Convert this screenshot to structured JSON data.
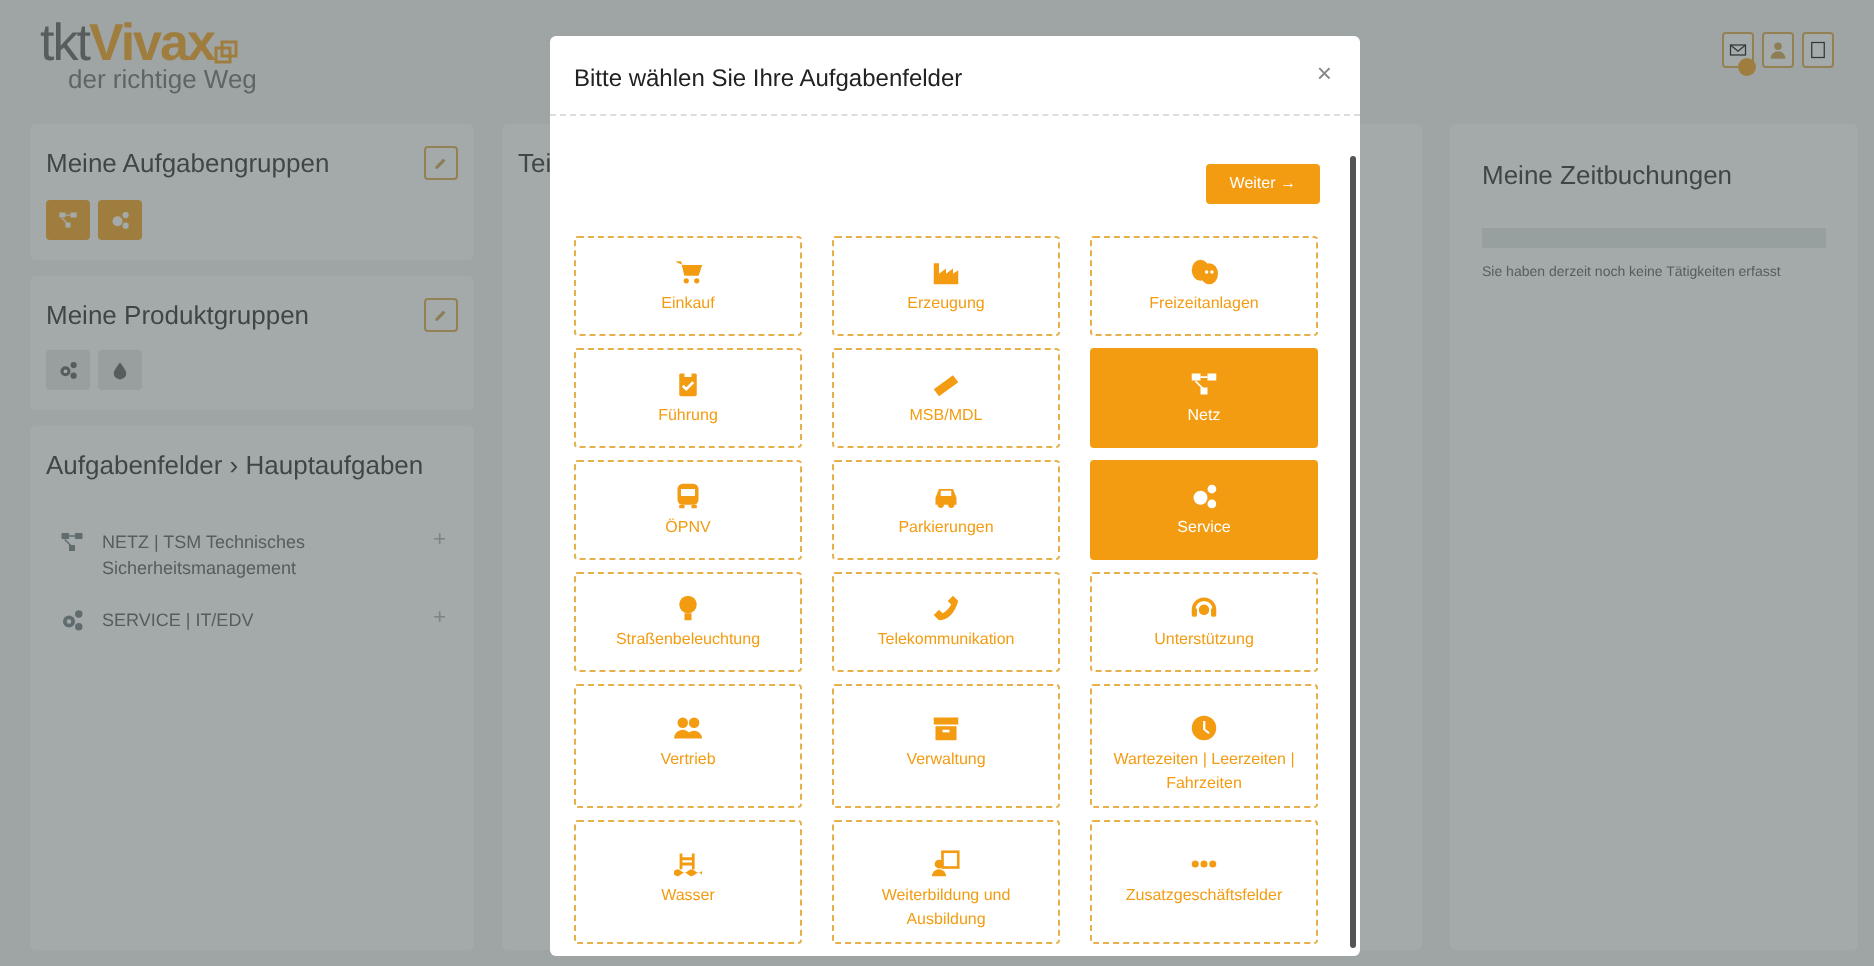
{
  "header": {
    "logo_prefix": "tkt",
    "logo_brand": "Vivax",
    "tagline": "der richtige Weg",
    "notification_badge": true
  },
  "left_cards": [
    {
      "title": "Meine Aufgabengruppen",
      "kind": "groups",
      "buttons_active": true
    },
    {
      "title": "Meine Produktgruppen",
      "kind": "products",
      "buttons_active": false
    }
  ],
  "task_card": {
    "title": "Aufgabenfelder › Hauptaufgaben",
    "items": [
      {
        "label": "NETZ | TSM Technisches Sicherheitsmanagement",
        "action": "+"
      },
      {
        "label": "SERVICE | IT/EDV",
        "action": "+"
      }
    ]
  },
  "middle_card": {
    "title": "Tei"
  },
  "right_card": {
    "title": "Meine Zeitbuchungen",
    "message": "Sie haben derzeit noch keine Tätigkeiten erfasst"
  },
  "modal": {
    "title": "Bitte wählen Sie Ihre Aufgabenfelder",
    "close": "×",
    "next_button": "Weiter →",
    "tiles": [
      {
        "label": "Einkauf",
        "selected": false
      },
      {
        "label": "Erzeugung",
        "selected": false
      },
      {
        "label": "Freizeitanlagen",
        "selected": false
      },
      {
        "label": "Führung",
        "selected": false
      },
      {
        "label": "MSB/MDL",
        "selected": false
      },
      {
        "label": "Netz",
        "selected": true
      },
      {
        "label": "ÖPNV",
        "selected": false
      },
      {
        "label": "Parkierungen",
        "selected": false
      },
      {
        "label": "Service",
        "selected": true
      },
      {
        "label": "Straßenbeleuchtung",
        "selected": false
      },
      {
        "label": "Telekommunikation",
        "selected": false
      },
      {
        "label": "Unterstützung",
        "selected": false
      },
      {
        "label": "Vertrieb",
        "selected": false
      },
      {
        "label": "Verwaltung",
        "selected": false
      },
      {
        "label": "Wartezeiten | Leerzeiten | Fahrzeiten",
        "selected": false
      },
      {
        "label": "Wasser",
        "selected": false
      },
      {
        "label": "Weiterbildung und Ausbildung",
        "selected": false
      },
      {
        "label": "Zusatzgeschäftsfelder",
        "selected": false
      }
    ]
  }
}
